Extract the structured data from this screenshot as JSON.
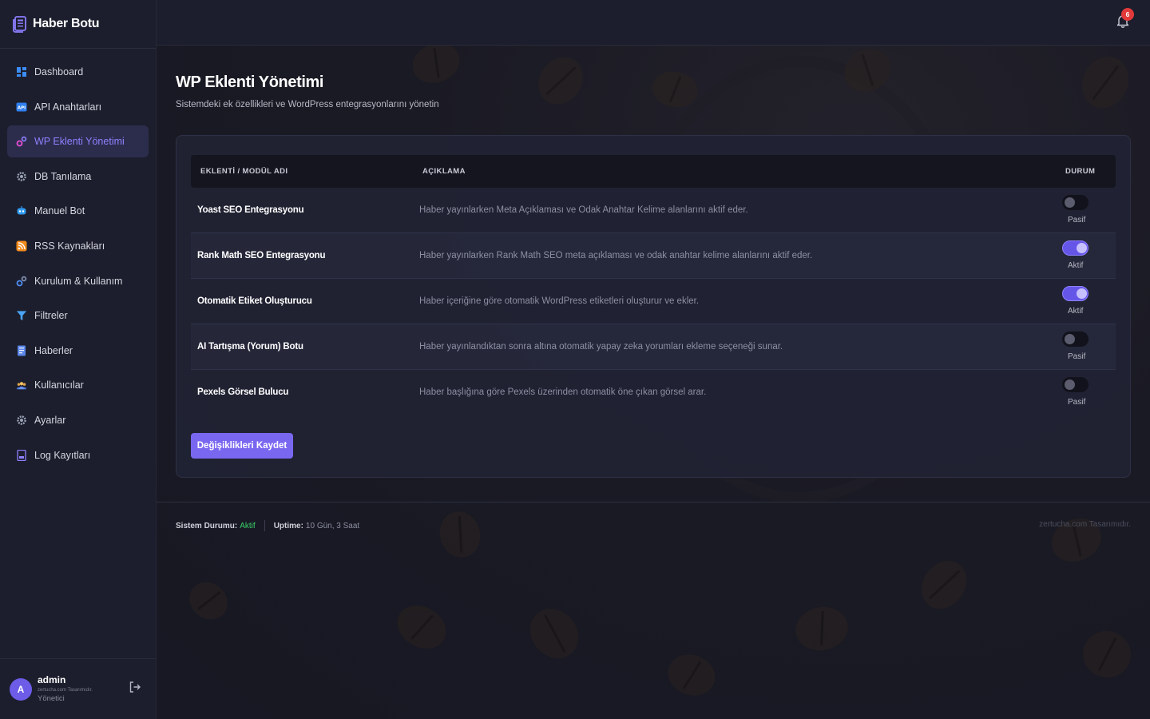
{
  "brand": {
    "title": "Haber Botu"
  },
  "sidebar": {
    "items": [
      {
        "label": "Dashboard",
        "icon": "dashboard-icon"
      },
      {
        "label": "API Anahtarları",
        "icon": "api-icon"
      },
      {
        "label": "WP Eklenti Yönetimi",
        "icon": "gears-icon",
        "active": true
      },
      {
        "label": "DB Tanılama",
        "icon": "gear-icon"
      },
      {
        "label": "Manuel Bot",
        "icon": "robot-icon"
      },
      {
        "label": "RSS Kaynakları",
        "icon": "rss-icon"
      },
      {
        "label": "Kurulum & Kullanım",
        "icon": "gears-icon"
      },
      {
        "label": "Filtreler",
        "icon": "filter-icon"
      },
      {
        "label": "Haberler",
        "icon": "newspaper-icon"
      },
      {
        "label": "Kullanıcılar",
        "icon": "users-icon"
      },
      {
        "label": "Ayarlar",
        "icon": "gear-icon"
      },
      {
        "label": "Log Kayıtları",
        "icon": "log-icon"
      }
    ]
  },
  "user": {
    "initial": "A",
    "name": "admin",
    "credit": "zertucha.com Tasarımıdır.",
    "role": "Yönetici"
  },
  "topbar": {
    "notification_count": "6"
  },
  "page": {
    "title": "WP Eklenti Yönetimi",
    "subtitle": "Sistemdeki ek özellikleri ve WordPress entegrasyonlarını yönetin"
  },
  "table": {
    "headers": {
      "name": "EKLENTİ / MODÜL ADI",
      "desc": "AÇIKLAMA",
      "status": "DURUM"
    },
    "rows": [
      {
        "name": "Yoast SEO Entegrasyonu",
        "desc": "Haber yayınlarken Meta Açıklaması ve Odak Anahtar Kelime alanlarını aktif eder.",
        "enabled": false,
        "status": "Pasif"
      },
      {
        "name": "Rank Math SEO Entegrasyonu",
        "desc": "Haber yayınlarken Rank Math SEO meta açıklaması ve odak anahtar kelime alanlarını aktif eder.",
        "enabled": true,
        "status": "Aktif"
      },
      {
        "name": "Otomatik Etiket Oluşturucu",
        "desc": "Haber içeriğine göre otomatik WordPress etiketleri oluşturur ve ekler.",
        "enabled": true,
        "status": "Aktif"
      },
      {
        "name": "AI Tartışma (Yorum) Botu",
        "desc": "Haber yayınlandıktan sonra altına otomatik yapay zeka yorumları ekleme seçeneği sunar.",
        "enabled": false,
        "status": "Pasif"
      },
      {
        "name": "Pexels Görsel Bulucu",
        "desc": "Haber başlığına göre Pexels üzerinden otomatik öne çıkan görsel arar.",
        "enabled": false,
        "status": "Pasif"
      }
    ]
  },
  "save_label": "Değişiklikleri Kaydet",
  "footer": {
    "system_label": "Sistem Durumu:",
    "system_value": "Aktif",
    "uptime_label": "Uptime:",
    "uptime_value": "10 Gün, 3 Saat",
    "credit": "zertucha.com Tasarımıdır."
  },
  "colors": {
    "accent": "#7a67f0",
    "active_text": "#8f80ff",
    "ok": "#3ad16b",
    "badge": "#e23a3a"
  }
}
